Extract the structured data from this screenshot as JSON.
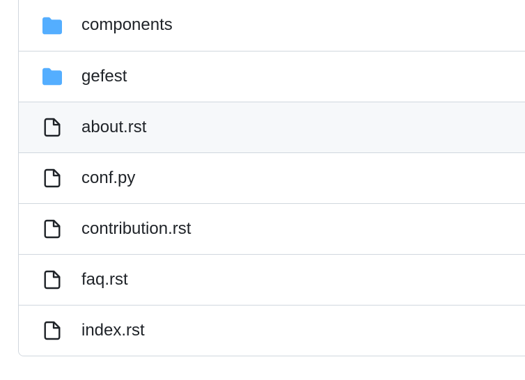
{
  "icons": {
    "folder_fill": "#54aeff",
    "file_stroke": "#1f2328"
  },
  "items": [
    {
      "type": "folder",
      "name": "components",
      "highlight": false
    },
    {
      "type": "folder",
      "name": "gefest",
      "highlight": false
    },
    {
      "type": "file",
      "name": "about.rst",
      "highlight": true
    },
    {
      "type": "file",
      "name": "conf.py",
      "highlight": false
    },
    {
      "type": "file",
      "name": "contribution.rst",
      "highlight": false
    },
    {
      "type": "file",
      "name": "faq.rst",
      "highlight": false
    },
    {
      "type": "file",
      "name": "index.rst",
      "highlight": false
    }
  ]
}
